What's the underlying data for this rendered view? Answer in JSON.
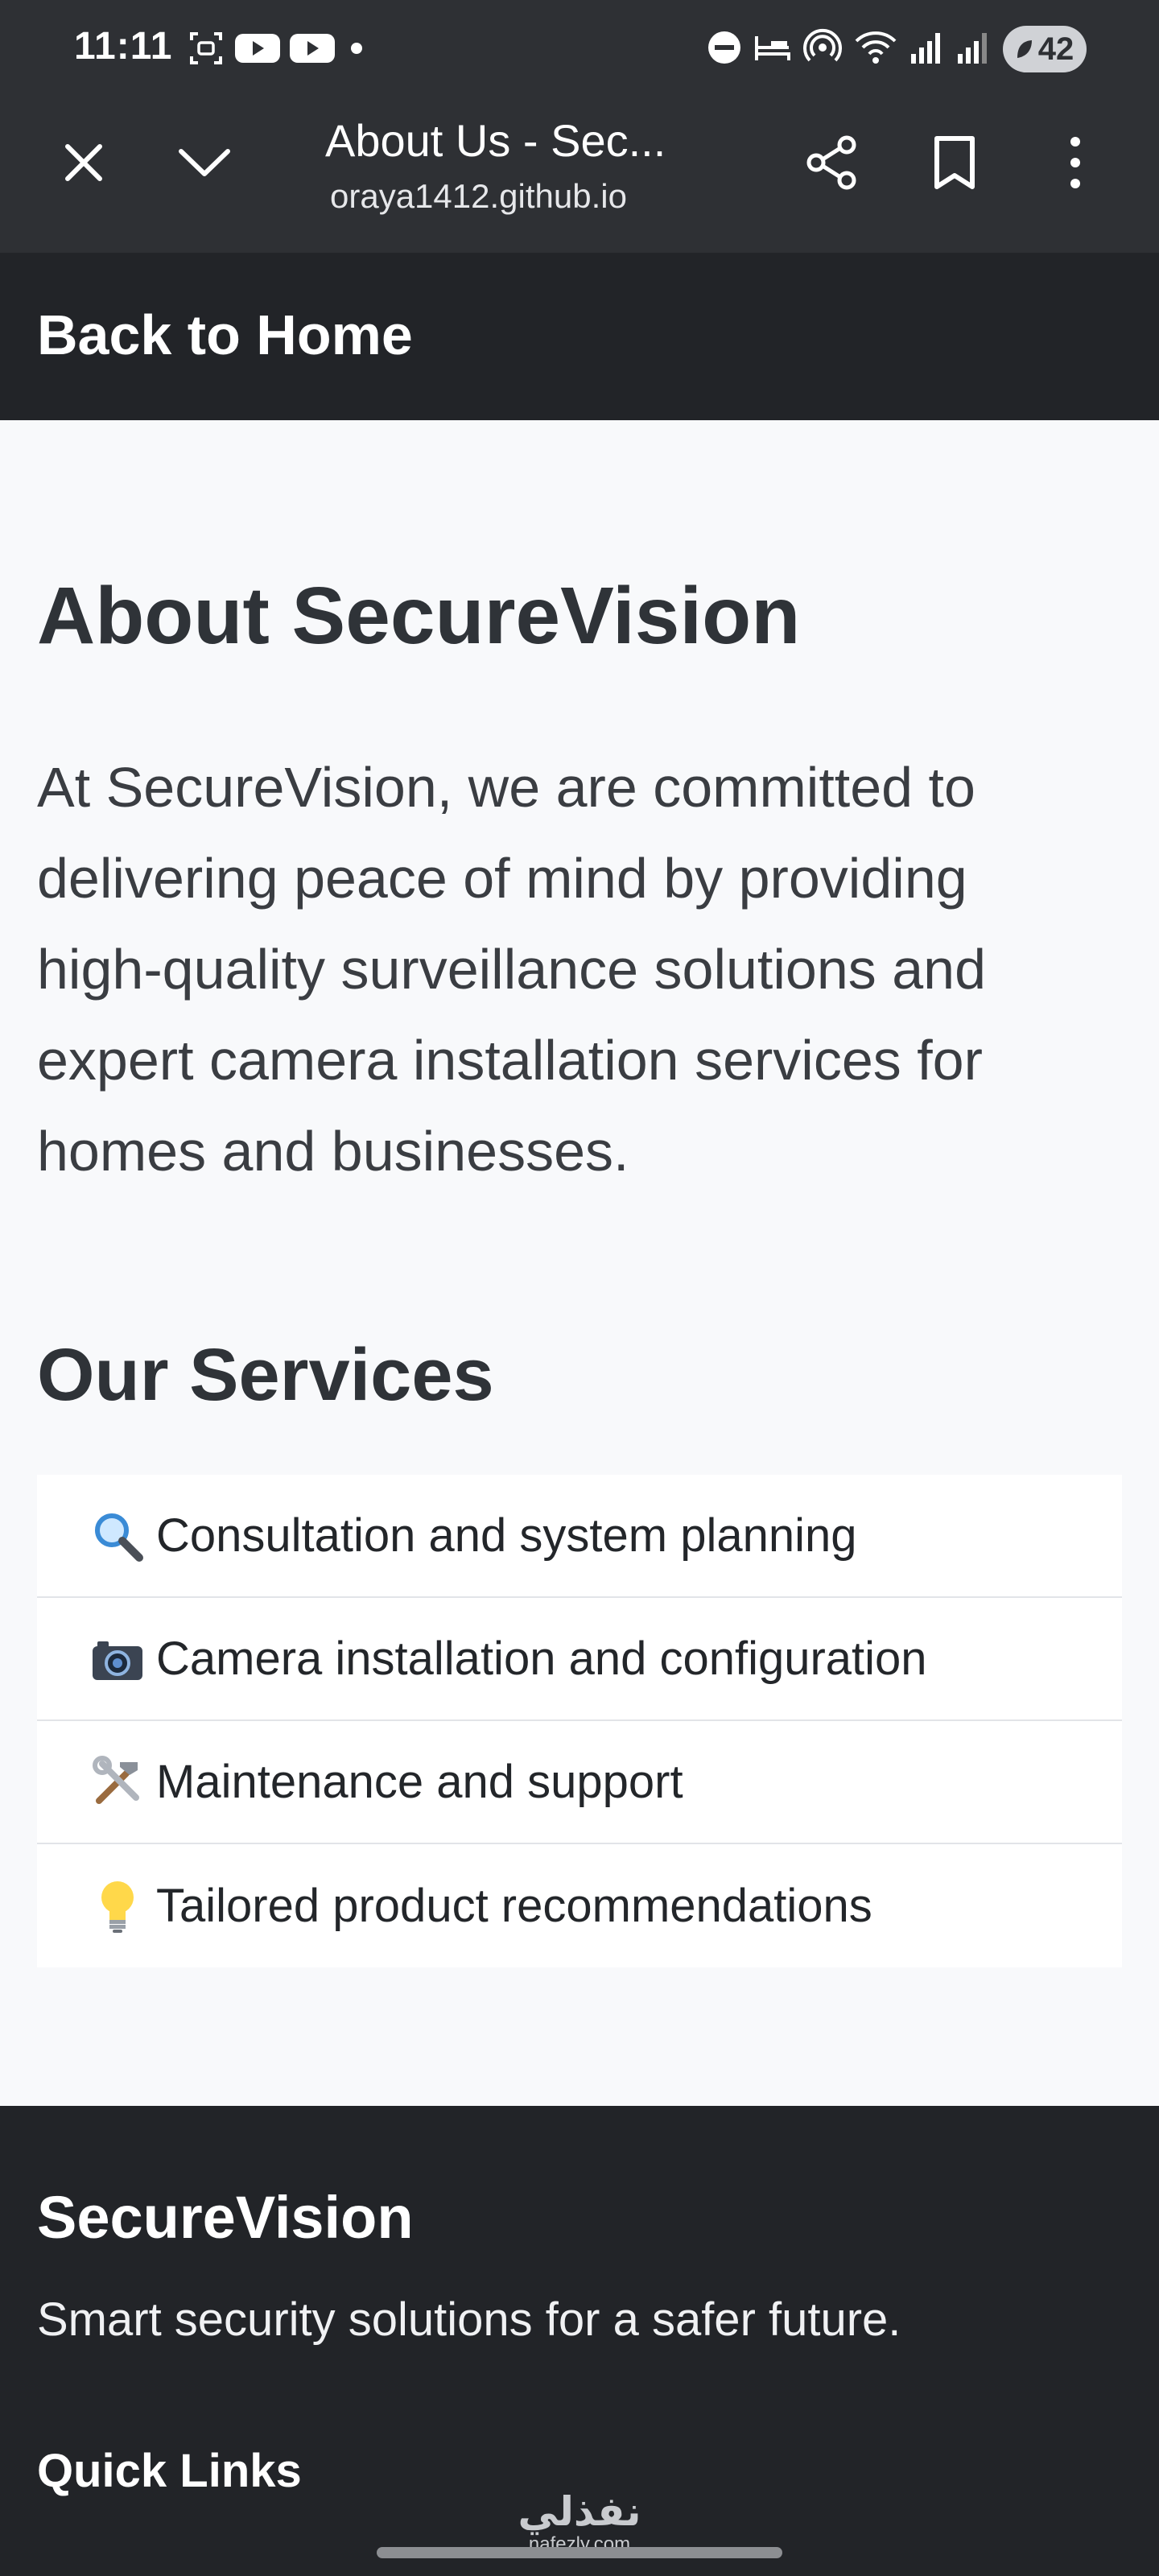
{
  "status_bar": {
    "time": "11:11",
    "battery": "42",
    "left_icons": [
      "screenshot-icon",
      "youtube-icon",
      "youtube-icon",
      "dot-icon"
    ],
    "right_icons": [
      "dnd-icon",
      "sleep-icon",
      "hotspot-icon",
      "wifi-icon",
      "signal-icon",
      "signal-icon"
    ]
  },
  "browser": {
    "title": "About Us - Sec...",
    "url": "oraya1412.github.io",
    "icons": [
      "close-icon",
      "chevron-down-icon",
      "share-icon",
      "bookmark-icon",
      "more-vert-icon"
    ]
  },
  "header": {
    "back_link": "Back to Home"
  },
  "about": {
    "title": "About SecureVision",
    "text": "At SecureVision, we are committed to delivering peace of mind by providing high-quality surveillance solutions and expert camera installation services for homes and businesses."
  },
  "services": {
    "title": "Our Services",
    "items": [
      {
        "icon": "magnifier-icon",
        "label": "Consultation and system planning"
      },
      {
        "icon": "camera-icon",
        "label": "Camera installation and configuration"
      },
      {
        "icon": "tools-icon",
        "label": "Maintenance and support"
      },
      {
        "icon": "lightbulb-icon",
        "label": "Tailored product recommendations"
      }
    ]
  },
  "footer": {
    "brand": "SecureVision",
    "tagline": "Smart security solutions for a safer future.",
    "quick_links_title": "Quick Links"
  },
  "watermark": {
    "arabic": "نفذلي",
    "latin": "nafezly.com"
  },
  "colors": {
    "status_bar_bg": "#2e3034",
    "header_bg": "#222428",
    "page_bg": "#f8f9fb",
    "card_bg": "#ffffff",
    "text_dark": "#2f3338"
  }
}
